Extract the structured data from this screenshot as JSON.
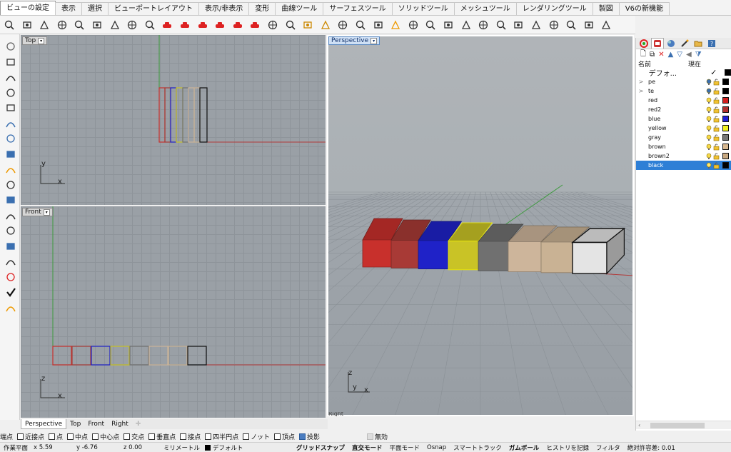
{
  "menu": {
    "tabs": [
      {
        "label": "ビューの設定",
        "active": true
      },
      {
        "label": "表示"
      },
      {
        "label": "選択"
      },
      {
        "label": "ビューポートレイアウト"
      },
      {
        "label": "表示/非表示"
      },
      {
        "label": "変形"
      },
      {
        "label": "曲線ツール"
      },
      {
        "label": "サーフェスツール"
      },
      {
        "label": "ソリッドツール"
      },
      {
        "label": "メッシュツール"
      },
      {
        "label": "レンダリングツール"
      },
      {
        "label": "製図"
      },
      {
        "label": "V6の新機能"
      }
    ]
  },
  "toolbar": {
    "icons": [
      "pan-icon",
      "rotate-view-icon",
      "zoom-window-icon",
      "zoom-dynamic-icon",
      "zoom-extents-icon",
      "zoom-selected-icon",
      "undo-view-icon",
      "zoom-in-icon",
      "zoom-target-icon",
      "car-front-icon",
      "car-red-icon",
      "car-red2-icon",
      "car-red3-icon",
      "car-red4-icon",
      "sport-car-icon",
      "camera-record-icon",
      "camera-icon",
      "named-view-icon",
      "named-cplane-icon",
      "search-zoom-icon",
      "zoom-out-icon",
      "compass-icon",
      "target-icon",
      "light-icon",
      "gumball-icon",
      "cube-icon",
      "move-icon",
      "align-icon",
      "plane-icon",
      "ufo-icon",
      "submarine-icon",
      "rotate-arrows-icon",
      "walk-icon",
      "sparkle-icon",
      "clock-icon"
    ]
  },
  "left_tools": [
    "point-icon",
    "polyline-icon",
    "circle-icon",
    "rectangle-icon",
    "curve-icon",
    "sphere-icon",
    "box-icon",
    "mesh-icon",
    "extrude-icon",
    "boolean-icon",
    "fillet-icon",
    "move-tool-icon",
    "array-icon",
    "dimension-icon",
    "text-tool-icon",
    "group-icon",
    "check-icon",
    "paint-icon"
  ],
  "viewports": {
    "top": {
      "title": "Top",
      "axis_y": "y",
      "axis_x": "x"
    },
    "front": {
      "title": "Front",
      "axis_y": "z",
      "axis_x": "x"
    },
    "perspective": {
      "title": "Perspective",
      "axis_z": "z",
      "axis_y": "y",
      "axis_x": "x",
      "partial_label": "Right"
    }
  },
  "viewport_tabs": [
    {
      "label": "Perspective",
      "active": true
    },
    {
      "label": "Top"
    },
    {
      "label": "Front"
    },
    {
      "label": "Right"
    }
  ],
  "layers_panel": {
    "col_name": "名前",
    "col_current": "現在",
    "layers": [
      {
        "name": "デフォ...",
        "current": true,
        "color": "#000000",
        "expand": ""
      },
      {
        "name": "pe",
        "color": "#000000",
        "expand": ">"
      },
      {
        "name": "te",
        "color": "#000000",
        "expand": ">"
      },
      {
        "name": "red",
        "color": "#d22020",
        "expand": ""
      },
      {
        "name": "red2",
        "color": "#b03030",
        "expand": ""
      },
      {
        "name": "blue",
        "color": "#1f1fd6",
        "expand": ""
      },
      {
        "name": "yellow",
        "color": "#f0f020",
        "expand": ""
      },
      {
        "name": "gray",
        "color": "#777777",
        "expand": ""
      },
      {
        "name": "brown",
        "color": "#d8b890",
        "expand": ""
      },
      {
        "name": "brown2",
        "color": "#c8a880",
        "expand": ""
      },
      {
        "name": "black",
        "color": "#000000",
        "expand": "",
        "selected": true
      }
    ]
  },
  "osnap": {
    "items": [
      {
        "label": "端点"
      },
      {
        "label": "近接点",
        "checked": false
      },
      {
        "label": "点",
        "checked": false
      },
      {
        "label": "中点",
        "checked": false
      },
      {
        "label": "中心点",
        "checked": false
      },
      {
        "label": "交点",
        "checked": false
      },
      {
        "label": "垂直点",
        "checked": false
      },
      {
        "label": "接点",
        "checked": false
      },
      {
        "label": "四半円点",
        "checked": false
      },
      {
        "label": "ノット",
        "checked": false
      },
      {
        "label": "頂点",
        "checked": false
      },
      {
        "label": "投影",
        "checked": true
      },
      {
        "label": "無効",
        "checked": false
      }
    ]
  },
  "status": {
    "cplane": "作業平面",
    "x": "x 5.59",
    "y": "y -6.76",
    "z": "z 0.00",
    "units": "ミリメートル",
    "layer": "デフォルト",
    "grid_snap": "グリッドスナップ",
    "ortho": "直交モード",
    "planar": "平面モード",
    "osnap": "Osnap",
    "smarttrack": "スマートトラック",
    "gumball": "ガムボール",
    "history": "ヒストリを記録",
    "filter": "フィルタ",
    "tolerance": "絶対許容差: 0.01"
  },
  "colors": {
    "red": "#c8302c",
    "red2": "#a83a36",
    "blue": "#1f22c8",
    "yellow": "#c9c326",
    "gray": "#707070",
    "brown": "#cdb59b",
    "brown2": "#c9b294",
    "white": "#e4e4e4"
  }
}
